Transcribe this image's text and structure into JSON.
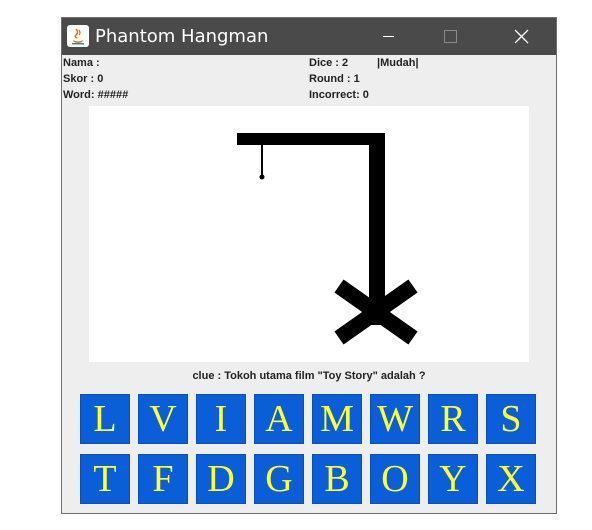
{
  "window": {
    "title": "Phantom Hangman"
  },
  "info": {
    "nama_label": "Nama :",
    "skor_label": "Skor : 0",
    "word_label": "Word: #####",
    "dice_label": "Dice : 2",
    "difficulty": "|Mudah|",
    "round_label": "Round : 1",
    "incorrect_label": "Incorrect: 0"
  },
  "clue": "clue : Tokoh utama film \"Toy Story\" adalah ?",
  "keyboard": {
    "row1": [
      "L",
      "V",
      "I",
      "A",
      "M",
      "W",
      "R",
      "S"
    ],
    "row2": [
      "T",
      "F",
      "D",
      "G",
      "B",
      "O",
      "Y",
      "X"
    ]
  },
  "colors": {
    "key_background": "#0a5fd8",
    "key_letter": "#ffff33",
    "titlebar": "#4a4a4a"
  }
}
